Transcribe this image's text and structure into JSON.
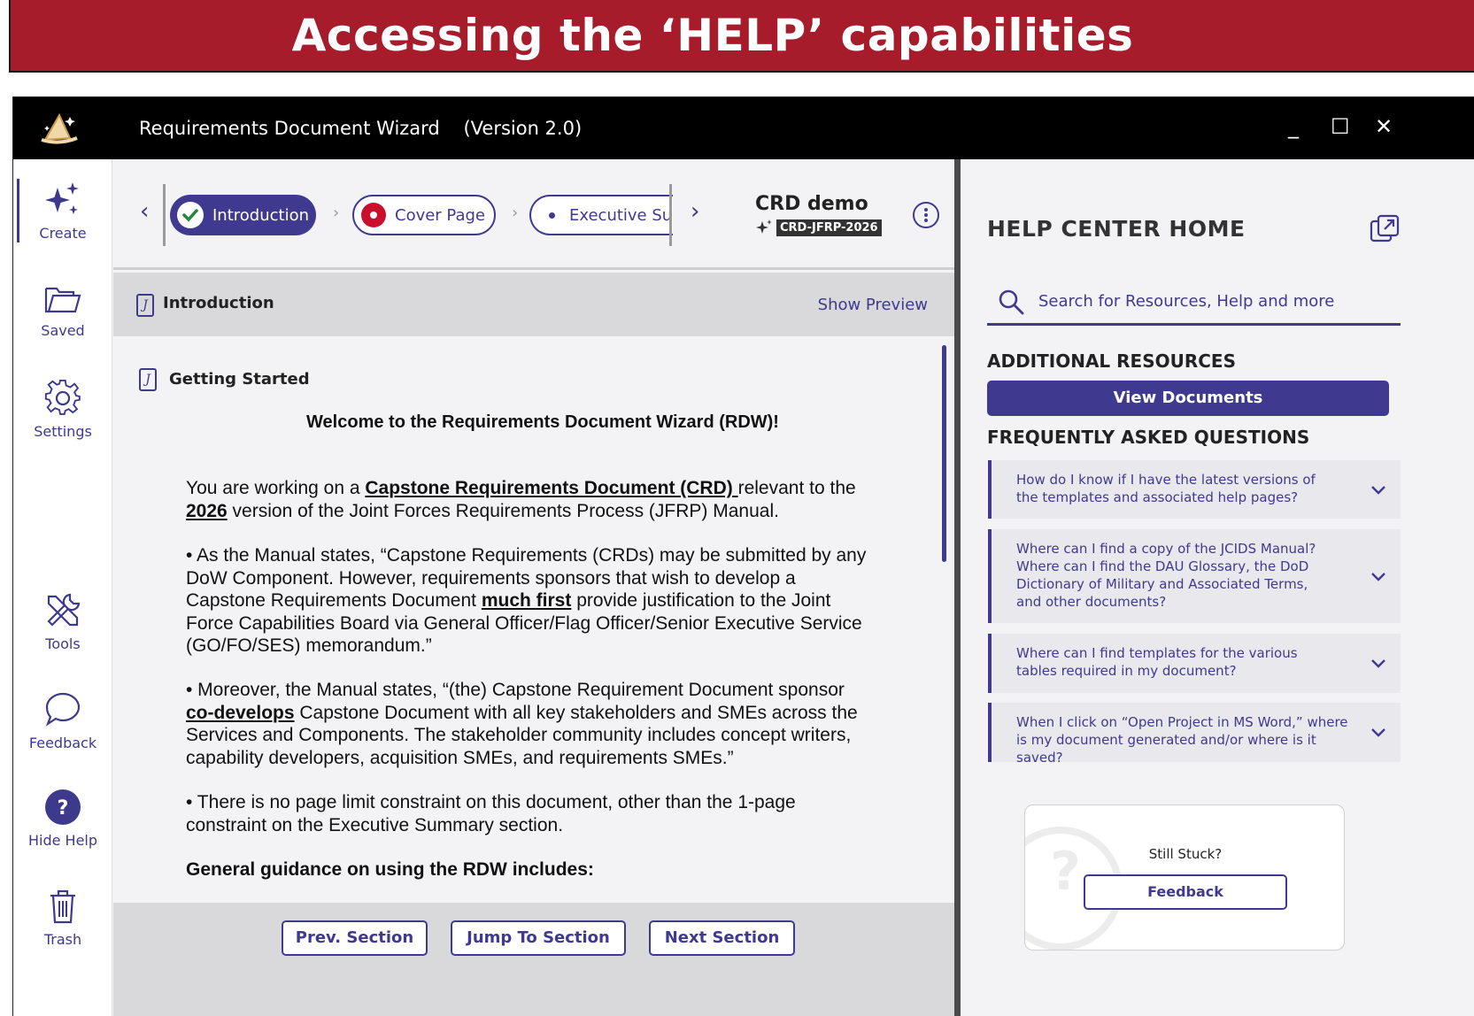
{
  "banner": {
    "title": "Accessing the ‘HELP’ capabilities"
  },
  "window": {
    "title": "Requirements Document Wizard    (Version 2.0)",
    "controls": {
      "minimize": "_",
      "maximize": "☐",
      "close": "✕"
    }
  },
  "rail": {
    "items": [
      {
        "label": "Create",
        "icon": "sparkles-icon"
      },
      {
        "label": "Saved",
        "icon": "folder-icon"
      },
      {
        "label": "Settings",
        "icon": "gear-icon"
      },
      {
        "label": "Tools",
        "icon": "tools-icon"
      },
      {
        "label": "Feedback",
        "icon": "chat-bubble-icon"
      },
      {
        "label": "Hide Help",
        "icon": "question-circle-icon"
      },
      {
        "label": "Trash",
        "icon": "trash-icon"
      }
    ]
  },
  "stepper": {
    "steps": [
      {
        "label": "Introduction",
        "state": "complete"
      },
      {
        "label": "Cover Page",
        "state": "error"
      },
      {
        "label": "Executive Su",
        "state": "pending"
      }
    ],
    "doc_name": "CRD demo",
    "doc_id": "CRD-JFRP-2026"
  },
  "section": {
    "title": "Introduction",
    "show_preview": "Show Preview"
  },
  "content": {
    "subsection": "Getting Started",
    "welcome": "Welcome to the Requirements Document Wizard (RDW)!",
    "p1": {
      "a": "You are working on a ",
      "link": "Capstone Requirements Document (CRD) ",
      "b": "relevant to the ",
      "year": "2026",
      "c": " version of the Joint Forces Requirements Process (JFRP) Manual."
    },
    "p2": {
      "a": "• As the Manual states, “Capstone Requirements (CRDs) may be submitted by any DoW Component. However, requirements sponsors that wish to develop a Capstone Requirements Document ",
      "em": "much first",
      "b": " provide justification to the Joint Force Capabilities Board via General Officer/Flag Officer/Senior Executive Service (GO/FO/SES) memorandum.”"
    },
    "p3": {
      "a": "• Moreover, the Manual states, “(the) Capstone Requirement Document sponsor ",
      "em": "co-develops",
      "b": " Capstone Document with all key stakeholders and SMEs across the Services and Components. The stakeholder community includes concept writers, capability developers, acquisition SMEs, and requirements SMEs.”"
    },
    "p4": "• There is no page limit constraint on this document, other than the 1-page constraint on the Executive Summary section.",
    "p5": "General guidance on using the RDW includes:"
  },
  "footer": {
    "prev": "Prev. Section",
    "jump": "Jump To Section",
    "next": "Next Section"
  },
  "help": {
    "title": "HELP CENTER HOME",
    "search_placeholder": "Search for Resources, Help and more",
    "resources_heading": "ADDITIONAL RESOURCES",
    "view_documents": "View Documents",
    "faq_heading": "FREQUENTLY ASKED QUESTIONS",
    "faqs": [
      "How do I know if I have the latest versions of the templates and associated help pages?",
      "Where can I find a copy of the JCIDS Manual? Where can I find the DAU Glossary, the DoD Dictionary of Military and Associated Terms, and other documents?",
      "Where can I find templates for the various tables required in my document?",
      "When I click on “Open Project in MS Word,” where is my document generated and/or where is it saved?"
    ],
    "stuck_text": "Still Stuck?",
    "stuck_button": "Feedback"
  },
  "colors": {
    "banner": "#a61c2b",
    "accent": "#3f3a8f",
    "success": "#1e8a3a",
    "error": "#c8102e"
  }
}
